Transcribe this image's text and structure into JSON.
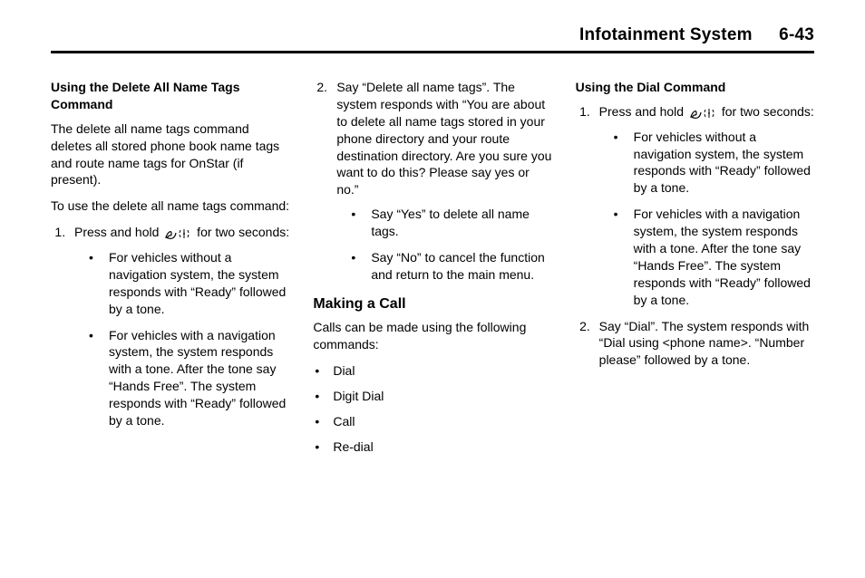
{
  "header": {
    "section": "Infotainment System",
    "pagenum": "6-43"
  },
  "col1": {
    "h1": "Using the Delete All Name Tags Command",
    "p1": "The delete all name tags command deletes all stored phone book name tags and route name tags for OnStar (if present).",
    "p2": "To use the delete all name tags command:",
    "step1_pre": "Press and hold ",
    "step1_post": " for two seconds:",
    "b1": "For vehicles without a navigation system, the system responds with “Ready” followed by a tone.",
    "b2": "For vehicles with a navigation system, the system responds with a tone. After the tone say “Hands Free”. The system responds with “Ready” followed by a tone."
  },
  "col2": {
    "step2": "Say “Delete all name tags”. The system responds with “You are about to delete all name tags stored in your phone directory and your route destination directory. Are you sure you want to do this? Please say yes or no.”",
    "sb1": "Say “Yes” to delete all name tags.",
    "sb2": "Say “No” to cancel the function and return to the main menu.",
    "h2": "Making a Call",
    "p1": "Calls can be made using the following commands:",
    "c1": "Dial",
    "c2": "Digit Dial",
    "c3": "Call",
    "c4": "Re-dial"
  },
  "col3": {
    "h1": "Using the Dial Command",
    "step1_pre": "Press and hold ",
    "step1_post": " for two seconds:",
    "b1": "For vehicles without a navigation system, the system responds with “Ready” followed by a tone.",
    "b2": "For vehicles with a navigation system, the system responds with a tone. After the tone say “Hands Free”. The system responds with “Ready” followed by a tone.",
    "step2": "Say “Dial”. The system responds with “Dial using <phone name>. “Number please” followed by a tone."
  }
}
